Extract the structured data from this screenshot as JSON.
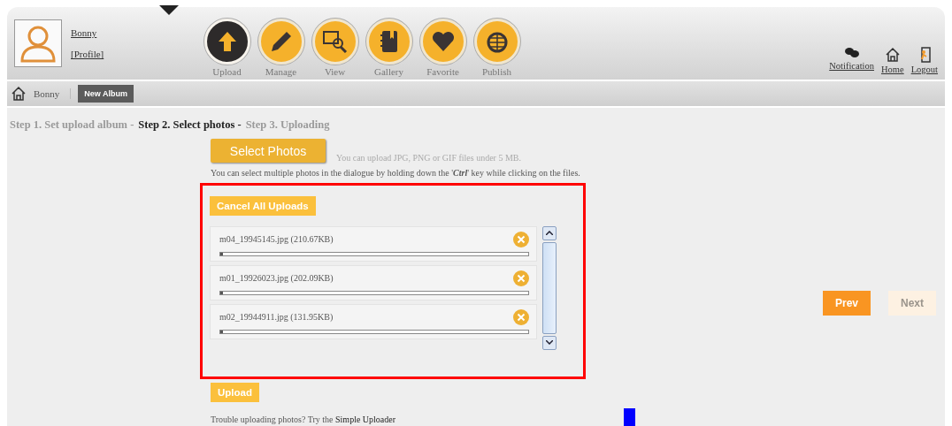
{
  "user": {
    "name": "Bonny",
    "profile_link": "[Profile]"
  },
  "nav": [
    {
      "label": "Upload",
      "selected": true
    },
    {
      "label": "Manage",
      "selected": false
    },
    {
      "label": "View",
      "selected": false
    },
    {
      "label": "Gallery",
      "selected": false
    },
    {
      "label": "Favorite",
      "selected": false
    },
    {
      "label": "Publish",
      "selected": false
    }
  ],
  "top_links": [
    {
      "label": "Notification"
    },
    {
      "label": "Home"
    },
    {
      "label": "Logout"
    }
  ],
  "breadcrumb": {
    "label": "Bonny",
    "button": "New Album"
  },
  "steps": [
    {
      "label": "Step 1. Set upload album -",
      "selected": false
    },
    {
      "label": "Step 2. Select photos -",
      "selected": true
    },
    {
      "label": "Step 3. Uploading",
      "selected": false
    }
  ],
  "select_button": "Select Photos",
  "file_hint": "You can upload JPG, PNG or GIF files under 5 MB.",
  "multi_hint": "You can select multiple photos in the dialogue by holding down the '**Ctrl**' key while clicking on the files.",
  "cancel_button": "Cancel All Uploads",
  "files": [
    {
      "name": "m04_19945145.jpg (210.67KB)",
      "level": 0.01
    },
    {
      "name": "m01_19926023.jpg (202.09KB)",
      "level": 0.01
    },
    {
      "name": "m02_19944911.jpg (131.95KB)",
      "level": 0.01
    }
  ],
  "upload_button": "Upload",
  "trouble_text": "Trouble uploading photos? Try the ",
  "trouble_link": "Simple Uploader",
  "prev_button": {
    "label": "Prev",
    "disabled": false
  },
  "next_button": {
    "label": "Next",
    "disabled": true
  }
}
